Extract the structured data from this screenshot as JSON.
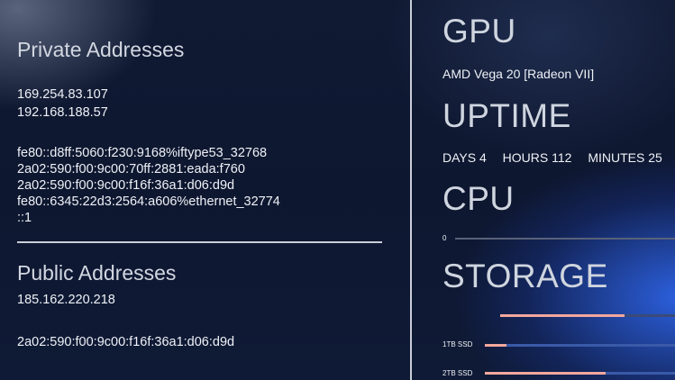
{
  "private": {
    "title": "Private Addresses",
    "ipv4": [
      "169.254.83.107",
      "192.168.188.57"
    ],
    "ipv6": [
      "fe80::d8ff:5060:f230:9168%iftype53_32768",
      "2a02:590:f00:9c00:70ff:2881:eada:f760",
      "2a02:590:f00:9c00:f16f:36a1:d06:d9d",
      "fe80::6345:22d3:2564:a606%ethernet_32774",
      "::1"
    ]
  },
  "public": {
    "title": "Public Addresses",
    "ipv4": "185.162.220.218",
    "ipv6": "2a02:590:f00:9c00:f16f:36a1:d06:d9d"
  },
  "gpu": {
    "title": "GPU",
    "name": "AMD Vega 20 [Radeon VII]"
  },
  "uptime": {
    "title": "UPTIME",
    "days": "DAYS 4",
    "hours": "HOURS 112",
    "minutes": "MINUTES 25"
  },
  "cpu": {
    "title": "CPU",
    "value_label": "0",
    "load_fraction": 0
  },
  "storage": {
    "title": "STORAGE",
    "overall_fraction": 0.69,
    "disks": [
      {
        "label": "1TB SSD",
        "fraction": 0.11
      },
      {
        "label": "2TB SSD",
        "fraction": 0.61
      }
    ]
  },
  "colors": {
    "bar_fill": "#f3a79d",
    "bar_track": "#3a5aa8",
    "divider": "#c9ced8"
  }
}
